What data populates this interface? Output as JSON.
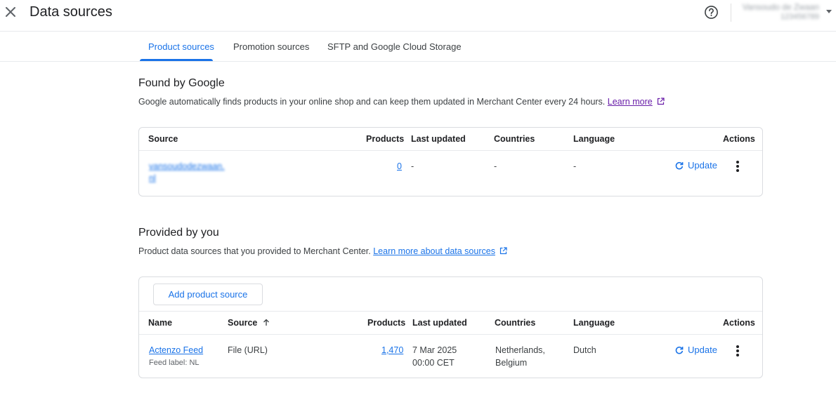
{
  "header": {
    "title": "Data sources",
    "account_name": "Vansoudo de Zwaan",
    "account_id": "123456789"
  },
  "tabs": [
    {
      "label": "Product sources",
      "active": true
    },
    {
      "label": "Promotion sources",
      "active": false
    },
    {
      "label": "SFTP and Google Cloud Storage",
      "active": false
    }
  ],
  "found": {
    "title": "Found by Google",
    "desc": "Google automatically finds products in your online shop and can keep them updated in Merchant Center every 24 hours.",
    "link": "Learn more",
    "columns": {
      "source": "Source",
      "products": "Products",
      "last_updated": "Last updated",
      "countries": "Countries",
      "language": "Language",
      "actions": "Actions"
    },
    "row": {
      "source_line1": "vansoudodezwaan.",
      "source_line2": "nl",
      "products": "0",
      "last_updated": "-",
      "countries": "-",
      "language": "-",
      "action": "Update"
    }
  },
  "provided": {
    "title": "Provided by you",
    "desc": "Product data sources that you provided to Merchant Center.",
    "link": "Learn more about data sources",
    "add_button": "Add product source",
    "columns": {
      "name": "Name",
      "source": "Source",
      "products": "Products",
      "last_updated": "Last updated",
      "countries": "Countries",
      "language": "Language",
      "actions": "Actions"
    },
    "row": {
      "name": "Actenzo Feed",
      "feed_label": "Feed label: NL",
      "source": "File (URL)",
      "products": "1,470",
      "last_updated_date": "7 Mar 2025",
      "last_updated_time": "00:00 CET",
      "countries_line1": "Netherlands,",
      "countries_line2": "Belgium",
      "language": "Dutch",
      "action": "Update"
    }
  },
  "colors": {
    "accent": "#1a73e8",
    "visited_link": "#681da8",
    "border": "#dadce0"
  },
  "icons": [
    "close-icon",
    "help-icon",
    "chevron-down-icon",
    "external-link-icon",
    "refresh-icon",
    "more-vert-icon",
    "arrow-up-icon"
  ]
}
